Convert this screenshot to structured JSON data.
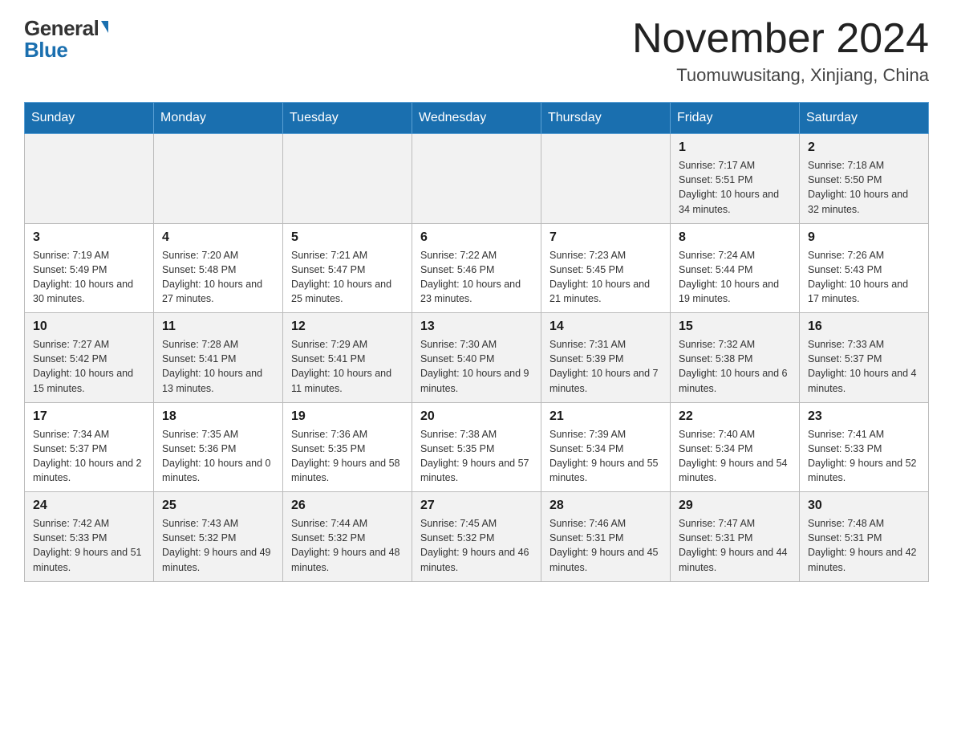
{
  "header": {
    "logo": {
      "general": "General",
      "blue": "Blue"
    },
    "month": "November 2024",
    "location": "Tuomuwusitang, Xinjiang, China"
  },
  "days_of_week": [
    "Sunday",
    "Monday",
    "Tuesday",
    "Wednesday",
    "Thursday",
    "Friday",
    "Saturday"
  ],
  "weeks": [
    {
      "days": [
        {
          "num": "",
          "info": ""
        },
        {
          "num": "",
          "info": ""
        },
        {
          "num": "",
          "info": ""
        },
        {
          "num": "",
          "info": ""
        },
        {
          "num": "",
          "info": ""
        },
        {
          "num": "1",
          "info": "Sunrise: 7:17 AM\nSunset: 5:51 PM\nDaylight: 10 hours and 34 minutes."
        },
        {
          "num": "2",
          "info": "Sunrise: 7:18 AM\nSunset: 5:50 PM\nDaylight: 10 hours and 32 minutes."
        }
      ]
    },
    {
      "days": [
        {
          "num": "3",
          "info": "Sunrise: 7:19 AM\nSunset: 5:49 PM\nDaylight: 10 hours and 30 minutes."
        },
        {
          "num": "4",
          "info": "Sunrise: 7:20 AM\nSunset: 5:48 PM\nDaylight: 10 hours and 27 minutes."
        },
        {
          "num": "5",
          "info": "Sunrise: 7:21 AM\nSunset: 5:47 PM\nDaylight: 10 hours and 25 minutes."
        },
        {
          "num": "6",
          "info": "Sunrise: 7:22 AM\nSunset: 5:46 PM\nDaylight: 10 hours and 23 minutes."
        },
        {
          "num": "7",
          "info": "Sunrise: 7:23 AM\nSunset: 5:45 PM\nDaylight: 10 hours and 21 minutes."
        },
        {
          "num": "8",
          "info": "Sunrise: 7:24 AM\nSunset: 5:44 PM\nDaylight: 10 hours and 19 minutes."
        },
        {
          "num": "9",
          "info": "Sunrise: 7:26 AM\nSunset: 5:43 PM\nDaylight: 10 hours and 17 minutes."
        }
      ]
    },
    {
      "days": [
        {
          "num": "10",
          "info": "Sunrise: 7:27 AM\nSunset: 5:42 PM\nDaylight: 10 hours and 15 minutes."
        },
        {
          "num": "11",
          "info": "Sunrise: 7:28 AM\nSunset: 5:41 PM\nDaylight: 10 hours and 13 minutes."
        },
        {
          "num": "12",
          "info": "Sunrise: 7:29 AM\nSunset: 5:41 PM\nDaylight: 10 hours and 11 minutes."
        },
        {
          "num": "13",
          "info": "Sunrise: 7:30 AM\nSunset: 5:40 PM\nDaylight: 10 hours and 9 minutes."
        },
        {
          "num": "14",
          "info": "Sunrise: 7:31 AM\nSunset: 5:39 PM\nDaylight: 10 hours and 7 minutes."
        },
        {
          "num": "15",
          "info": "Sunrise: 7:32 AM\nSunset: 5:38 PM\nDaylight: 10 hours and 6 minutes."
        },
        {
          "num": "16",
          "info": "Sunrise: 7:33 AM\nSunset: 5:37 PM\nDaylight: 10 hours and 4 minutes."
        }
      ]
    },
    {
      "days": [
        {
          "num": "17",
          "info": "Sunrise: 7:34 AM\nSunset: 5:37 PM\nDaylight: 10 hours and 2 minutes."
        },
        {
          "num": "18",
          "info": "Sunrise: 7:35 AM\nSunset: 5:36 PM\nDaylight: 10 hours and 0 minutes."
        },
        {
          "num": "19",
          "info": "Sunrise: 7:36 AM\nSunset: 5:35 PM\nDaylight: 9 hours and 58 minutes."
        },
        {
          "num": "20",
          "info": "Sunrise: 7:38 AM\nSunset: 5:35 PM\nDaylight: 9 hours and 57 minutes."
        },
        {
          "num": "21",
          "info": "Sunrise: 7:39 AM\nSunset: 5:34 PM\nDaylight: 9 hours and 55 minutes."
        },
        {
          "num": "22",
          "info": "Sunrise: 7:40 AM\nSunset: 5:34 PM\nDaylight: 9 hours and 54 minutes."
        },
        {
          "num": "23",
          "info": "Sunrise: 7:41 AM\nSunset: 5:33 PM\nDaylight: 9 hours and 52 minutes."
        }
      ]
    },
    {
      "days": [
        {
          "num": "24",
          "info": "Sunrise: 7:42 AM\nSunset: 5:33 PM\nDaylight: 9 hours and 51 minutes."
        },
        {
          "num": "25",
          "info": "Sunrise: 7:43 AM\nSunset: 5:32 PM\nDaylight: 9 hours and 49 minutes."
        },
        {
          "num": "26",
          "info": "Sunrise: 7:44 AM\nSunset: 5:32 PM\nDaylight: 9 hours and 48 minutes."
        },
        {
          "num": "27",
          "info": "Sunrise: 7:45 AM\nSunset: 5:32 PM\nDaylight: 9 hours and 46 minutes."
        },
        {
          "num": "28",
          "info": "Sunrise: 7:46 AM\nSunset: 5:31 PM\nDaylight: 9 hours and 45 minutes."
        },
        {
          "num": "29",
          "info": "Sunrise: 7:47 AM\nSunset: 5:31 PM\nDaylight: 9 hours and 44 minutes."
        },
        {
          "num": "30",
          "info": "Sunrise: 7:48 AM\nSunset: 5:31 PM\nDaylight: 9 hours and 42 minutes."
        }
      ]
    }
  ]
}
